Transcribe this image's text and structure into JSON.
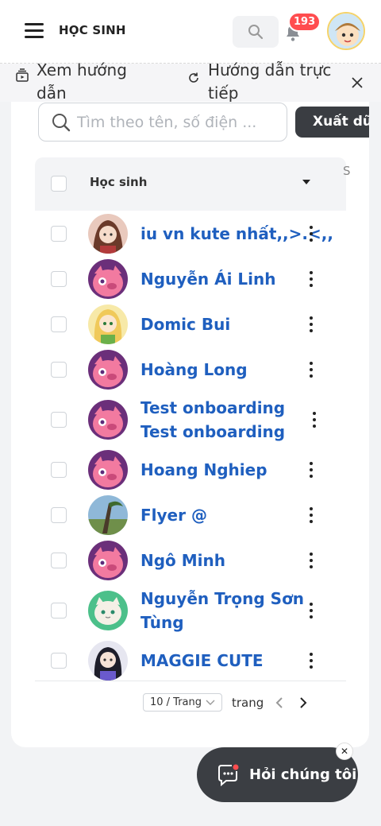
{
  "header": {
    "title": "HỌC SINH",
    "notification_count": "193",
    "icons": {
      "menu": "hamburger-icon",
      "search": "search-icon",
      "bell": "bell-icon"
    }
  },
  "guide": {
    "view_guide": "Xem hướng dẫn",
    "live_guide": "Hướng dẫn trực tiếp"
  },
  "toolbar": {
    "search_placeholder": "Tìm theo tên, số điện ...",
    "export_label": "Xuất dữ liệu"
  },
  "table": {
    "column_student": "Học sinh",
    "column_extra": "S",
    "rows": [
      {
        "name": "iu vn kute nhất,,>.<,,"
      },
      {
        "name": "Nguyễn Ái Linh"
      },
      {
        "name": "Domic Bui"
      },
      {
        "name": "Hoàng Long"
      },
      {
        "name": "Test onboarding Test onboarding"
      },
      {
        "name": "Hoang Nghiep"
      },
      {
        "name": "Flyer @"
      },
      {
        "name": "Ngô Minh"
      },
      {
        "name": "Nguyễn Trọng Sơn Tùng"
      },
      {
        "name": "MAGGIE CUTE"
      }
    ]
  },
  "pagination": {
    "page_size": "10 / Trang",
    "page_word": "trang"
  },
  "chat": {
    "label": "Hỏi chúng tôi"
  },
  "colors": {
    "accent": "#1f5fbf",
    "dark": "#3a3d42",
    "badge": "#ff4d4f"
  }
}
